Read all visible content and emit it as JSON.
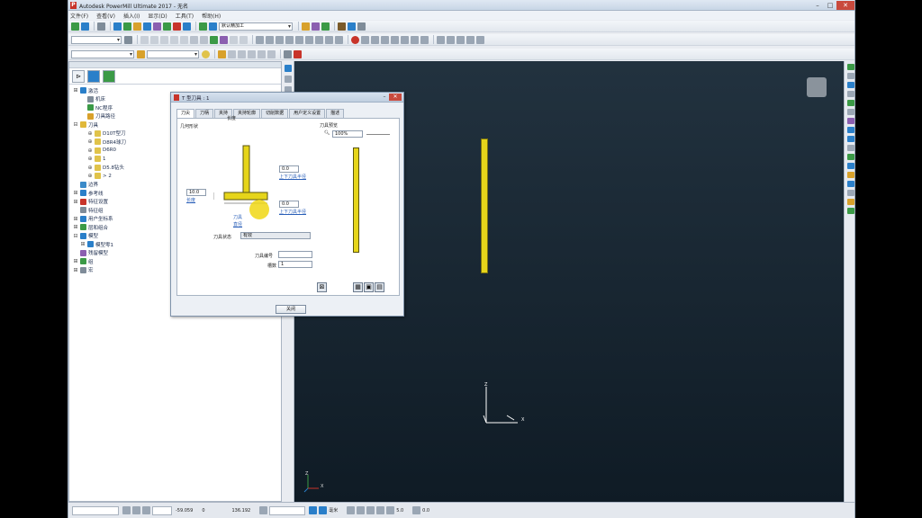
{
  "window": {
    "title": "Autodesk PowerMill Ultimate 2017 - 无名",
    "minimize": "–",
    "maximize": "□",
    "close": "✕"
  },
  "menubar": [
    "文件(F)",
    "查看(V)",
    "插入(I)",
    "显示(D)",
    "工具(T)",
    "帮助(H)"
  ],
  "toolbar1": {
    "strategy_combo": "默认精加工",
    "icon_colors": [
      "#2a7fc9",
      "#3b9a46",
      "#d8a12b",
      "#2a7fc9",
      "#8b5fb0",
      "#3b9a46",
      "#c8342a",
      "#2a7fc9",
      "#d8a12b",
      "#3b9a46",
      "#2a7fc9",
      "#c8342a",
      "#8b5fb0"
    ]
  },
  "toolbar2": {
    "combo": ""
  },
  "toolbar3": {
    "combo1": "",
    "combo2": ""
  },
  "explorer": {
    "items": [
      {
        "label": "激活",
        "color": "#2a7fc9",
        "indent": 0,
        "toggle": "⊞"
      },
      {
        "label": "机床",
        "color": "#7f8c99",
        "indent": 1,
        "toggle": ""
      },
      {
        "label": "NC程序",
        "color": "#3b9a46",
        "indent": 1,
        "toggle": ""
      },
      {
        "label": "刀具路径",
        "color": "#d8a12b",
        "indent": 1,
        "toggle": ""
      },
      {
        "label": "刀具",
        "color": "#e0b83a",
        "indent": 0,
        "toggle": "⊟"
      },
      {
        "label": "D10T型刀",
        "color": "#e0c34a",
        "indent": 2,
        "toggle": "⊕"
      },
      {
        "label": "D8R4球刀",
        "color": "#e0c34a",
        "indent": 2,
        "toggle": "⊕"
      },
      {
        "label": "D6R0",
        "color": "#e0c34a",
        "indent": 2,
        "toggle": "⊕"
      },
      {
        "label": "1",
        "color": "#e0c34a",
        "indent": 2,
        "toggle": "⊕"
      },
      {
        "label": "D5.8钻头",
        "color": "#e0c34a",
        "indent": 2,
        "toggle": "⊕"
      },
      {
        "label": "> 2",
        "color": "#e0c34a",
        "indent": 2,
        "toggle": "⊕"
      },
      {
        "label": "边界",
        "color": "#3a8ac9",
        "indent": 0,
        "toggle": ""
      },
      {
        "label": "参考线",
        "color": "#2a7fc9",
        "indent": 0,
        "toggle": "⊞"
      },
      {
        "label": "特征设置",
        "color": "#c8342a",
        "indent": 0,
        "toggle": "⊞"
      },
      {
        "label": "特征组",
        "color": "#7f8c99",
        "indent": 0,
        "toggle": ""
      },
      {
        "label": "用户坐标系",
        "color": "#2a7fc9",
        "indent": 0,
        "toggle": "⊞"
      },
      {
        "label": "层和组合",
        "color": "#3b9a46",
        "indent": 0,
        "toggle": "⊞"
      },
      {
        "label": "模型",
        "color": "#2a7fc9",
        "indent": 0,
        "toggle": "⊟"
      },
      {
        "label": "模型零1",
        "color": "#2a7fc9",
        "indent": 1,
        "toggle": "⊞"
      },
      {
        "label": "残留模型",
        "color": "#8b5fb0",
        "indent": 0,
        "toggle": ""
      },
      {
        "label": "组",
        "color": "#3b9a46",
        "indent": 0,
        "toggle": "⊞"
      },
      {
        "label": "宏",
        "color": "#7f8c99",
        "indent": 0,
        "toggle": "⊞"
      }
    ]
  },
  "dialog": {
    "title": "T 型刀具 : 1",
    "tabs": [
      "刀尖",
      "刀柄",
      "夹持",
      "夹持轮廓",
      "切削数据",
      "用户定义设置",
      "描述"
    ],
    "active_tab": 0,
    "geometry_label": "几何形状",
    "length_label": "长度",
    "length_value": "10.0",
    "length_link": "长度",
    "upper_value": "0.0",
    "upper_link": "上下刀具半径",
    "lower_value": "0.0",
    "lower_link": "上下刀具半径",
    "diameter_label": "刀具",
    "diameter_link": "直径",
    "tool_state_label": "刀具状态",
    "tool_state_value": "有效",
    "tool_number_label": "刀具编号",
    "tool_number_value": "",
    "slots_label": "槽数",
    "slots_value": "1",
    "preview_label": "刀具预览",
    "zoom_value": "100%",
    "close_button": "关闭"
  },
  "viewport": {
    "axis_x": "X",
    "axis_z": "Z",
    "mini_x": "X",
    "mini_z": "Z",
    "tool_color": "#e6d51a"
  },
  "statusbar": {
    "field1": "",
    "x_value": "-59.059",
    "y_value": "0",
    "z_value": "136.192",
    "field2": "",
    "field3": "",
    "mode_label": "毫米",
    "tol_value": "5.0",
    "step_value": "0.0"
  }
}
